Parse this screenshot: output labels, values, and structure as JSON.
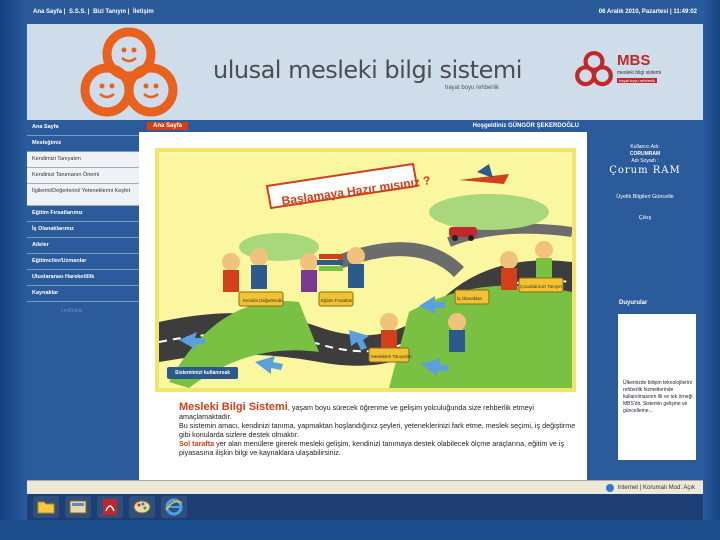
{
  "topbar": {
    "links": [
      "Ana Sayfa",
      "S.S.S.",
      "Bizi Tanıyın",
      "İletişim"
    ],
    "separator": "|",
    "date": "06 Aralık 2010, Pazartesi",
    "time": "11:49:02"
  },
  "header": {
    "title": "ulusal mesleki bilgi sistemi",
    "subtitle": "hayat boyu rehberlik",
    "mbs_logo": "MBS",
    "mbs_sub": "mesleki bilgi sistemi",
    "mbs_sub2": "hayat boyu rehberlik"
  },
  "leftnav": {
    "items": [
      {
        "label": "Ana Sayfa",
        "style": "dark"
      },
      {
        "label": "Mesleğimiz",
        "style": "dark"
      },
      {
        "label": "Kendimizi Tanıyalım",
        "style": "light"
      },
      {
        "label": "Kendinizi Tanımanın Önemi",
        "style": "light"
      },
      {
        "label": "İlgilerini/Değerlerini/ Yeteneklerini Keşfet",
        "style": "light-double"
      },
      {
        "label": "Eğitim Fırsatlarımız",
        "style": "dark"
      },
      {
        "label": "İş Olanaklarımız",
        "style": "dark"
      },
      {
        "label": "Aileler",
        "style": "dark"
      },
      {
        "label": "Eğitimciler/Uzmanlar",
        "style": "dark"
      },
      {
        "label": "Uluslararası Hareketlilik",
        "style": "dark"
      },
      {
        "label": "Kaynaklar",
        "style": "dark"
      }
    ],
    "faded": "LinkSitesi"
  },
  "content": {
    "tab": "Ana Sayfa",
    "welcome": "Hoşgeldiniz GÜNGÖR ŞEKERDOĞLU",
    "banner": "Başlamaya Hazır mısınız ?",
    "cta": "Sistemimizi kullanırsak",
    "signs": {
      "kendini": "Kendini Değerlendir",
      "egitim": "Eğitim Fırsatları",
      "meslekler": "Meslekleri Tanıyalım",
      "is": "İş Olanakları",
      "cocuk": "Çocuklarınızı Tanıyın"
    },
    "desc": {
      "brand": "Mesleki Bilgi Sistemi",
      "line1": ", yaşam boyu sürecek öğrenme ve gelişim yolculuğunda size rehberlik etmeyi amaçlamaktadır.",
      "line2": "Bu sistemin amacı, kendinizi tanıma, yapmaktan hoşlandığınız şeyleri, yeteneklerinizi fark etme, meslek seçimi, iş değiştirme gibi konularda sizlere destek olmaktır.",
      "lead3": "Sol tarafta",
      "line3": " yer alan menülere girerek mesleki gelişim, kendinizi tanımaya destek olabilecek ölçme araçlarına, eğitim ve iş piyasasına ilişkin bilgi ve kaynaklara ulaşabilirsiniz."
    }
  },
  "rightpanel": {
    "user_label": "Kullanıcı Adı:",
    "user_value": "CORUMRAM",
    "name_label": "Adı Soyadı :",
    "name_value": "Çorum RAM",
    "profile_link": "Üyelik Bilgileri Güncelle",
    "logout": "Çıkış",
    "duyurular_title": "Duyurular",
    "duyurular_text": "Ülkemizde bilişim teknolojilerini rehberlik hizmetlerinde kullanılmasının ilk ve tek örneği MBS'dir. Sistemin gelişme ve güncelleme..."
  },
  "status": {
    "zone": "Internet | Korumalı Mod: Açık"
  },
  "colors": {
    "nav_blue": "#2b5b9b",
    "accent_orange": "#d2401b",
    "brand_red": "#c0282c",
    "illus_yellow": "#fbf6a0"
  }
}
